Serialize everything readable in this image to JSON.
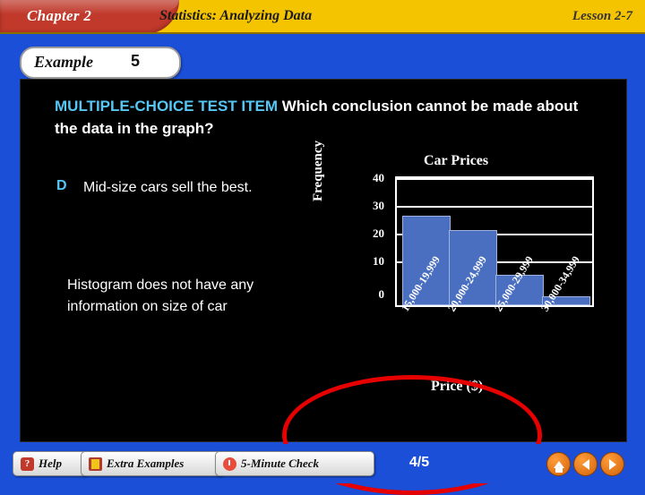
{
  "header": {
    "chapter": "Chapter 2",
    "title": "Statistics: Analyzing Data",
    "lesson": "Lesson 2-7"
  },
  "example_tab": {
    "label": "Example",
    "number": "5"
  },
  "slide": {
    "prompt_highlight": "MULTIPLE-CHOICE TEST ITEM",
    "prompt_rest": "Which conclusion cannot be made about the data in the graph?",
    "choice_letter": "D",
    "choice_text": "Mid-size cars sell the best.",
    "note": "Histogram does not have any information on size of car"
  },
  "chart_data": {
    "type": "bar",
    "title": "Car Prices",
    "xlabel": "Price ($)",
    "ylabel": "Frequency",
    "categories": [
      "15,000-19,999",
      "20,000-24,999",
      "25,000-29,999",
      "30,000-34,999"
    ],
    "values": [
      31,
      26,
      10,
      2
    ],
    "ylim": [
      0,
      45
    ],
    "yticks": [
      "0",
      "10",
      "20",
      "30",
      "40"
    ],
    "grid": true,
    "bar_color": "#4a6fc0"
  },
  "footer": {
    "help_label": "Help",
    "help_icon": "question-mark-icon",
    "extra_examples_label": "Extra Examples",
    "extra_examples_icon": "book-icon",
    "five_minute_check_label": "5-Minute Check",
    "five_minute_check_icon": "clock-icon",
    "page": "4/5",
    "home_icon": "home-icon",
    "prev_icon": "previous-arrow-icon",
    "next_icon": "next-arrow-icon"
  }
}
